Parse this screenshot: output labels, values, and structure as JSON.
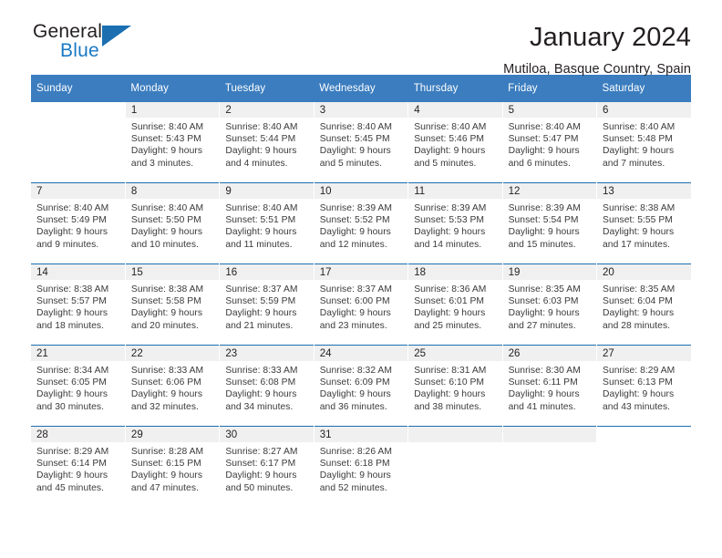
{
  "brand": {
    "name_part1": "General",
    "name_part2": "Blue",
    "triangle_icon": "triangle-icon",
    "blue": "#1b79c4"
  },
  "header": {
    "title": "January 2024",
    "location": "Mutiloa, Basque Country, Spain"
  },
  "calendar": {
    "header_bg": "#3b7dbf",
    "daynum_bg": "#f0f0f0",
    "separator_color": "#1b6fb0",
    "weekdays": [
      "Sunday",
      "Monday",
      "Tuesday",
      "Wednesday",
      "Thursday",
      "Friday",
      "Saturday"
    ],
    "weeks": [
      [
        null,
        {
          "day": "1",
          "sunrise": "Sunrise: 8:40 AM",
          "sunset": "Sunset: 5:43 PM",
          "daylight1": "Daylight: 9 hours",
          "daylight2": "and 3 minutes."
        },
        {
          "day": "2",
          "sunrise": "Sunrise: 8:40 AM",
          "sunset": "Sunset: 5:44 PM",
          "daylight1": "Daylight: 9 hours",
          "daylight2": "and 4 minutes."
        },
        {
          "day": "3",
          "sunrise": "Sunrise: 8:40 AM",
          "sunset": "Sunset: 5:45 PM",
          "daylight1": "Daylight: 9 hours",
          "daylight2": "and 5 minutes."
        },
        {
          "day": "4",
          "sunrise": "Sunrise: 8:40 AM",
          "sunset": "Sunset: 5:46 PM",
          "daylight1": "Daylight: 9 hours",
          "daylight2": "and 5 minutes."
        },
        {
          "day": "5",
          "sunrise": "Sunrise: 8:40 AM",
          "sunset": "Sunset: 5:47 PM",
          "daylight1": "Daylight: 9 hours",
          "daylight2": "and 6 minutes."
        },
        {
          "day": "6",
          "sunrise": "Sunrise: 8:40 AM",
          "sunset": "Sunset: 5:48 PM",
          "daylight1": "Daylight: 9 hours",
          "daylight2": "and 7 minutes."
        }
      ],
      [
        {
          "day": "7",
          "sunrise": "Sunrise: 8:40 AM",
          "sunset": "Sunset: 5:49 PM",
          "daylight1": "Daylight: 9 hours",
          "daylight2": "and 9 minutes."
        },
        {
          "day": "8",
          "sunrise": "Sunrise: 8:40 AM",
          "sunset": "Sunset: 5:50 PM",
          "daylight1": "Daylight: 9 hours",
          "daylight2": "and 10 minutes."
        },
        {
          "day": "9",
          "sunrise": "Sunrise: 8:40 AM",
          "sunset": "Sunset: 5:51 PM",
          "daylight1": "Daylight: 9 hours",
          "daylight2": "and 11 minutes."
        },
        {
          "day": "10",
          "sunrise": "Sunrise: 8:39 AM",
          "sunset": "Sunset: 5:52 PM",
          "daylight1": "Daylight: 9 hours",
          "daylight2": "and 12 minutes."
        },
        {
          "day": "11",
          "sunrise": "Sunrise: 8:39 AM",
          "sunset": "Sunset: 5:53 PM",
          "daylight1": "Daylight: 9 hours",
          "daylight2": "and 14 minutes."
        },
        {
          "day": "12",
          "sunrise": "Sunrise: 8:39 AM",
          "sunset": "Sunset: 5:54 PM",
          "daylight1": "Daylight: 9 hours",
          "daylight2": "and 15 minutes."
        },
        {
          "day": "13",
          "sunrise": "Sunrise: 8:38 AM",
          "sunset": "Sunset: 5:55 PM",
          "daylight1": "Daylight: 9 hours",
          "daylight2": "and 17 minutes."
        }
      ],
      [
        {
          "day": "14",
          "sunrise": "Sunrise: 8:38 AM",
          "sunset": "Sunset: 5:57 PM",
          "daylight1": "Daylight: 9 hours",
          "daylight2": "and 18 minutes."
        },
        {
          "day": "15",
          "sunrise": "Sunrise: 8:38 AM",
          "sunset": "Sunset: 5:58 PM",
          "daylight1": "Daylight: 9 hours",
          "daylight2": "and 20 minutes."
        },
        {
          "day": "16",
          "sunrise": "Sunrise: 8:37 AM",
          "sunset": "Sunset: 5:59 PM",
          "daylight1": "Daylight: 9 hours",
          "daylight2": "and 21 minutes."
        },
        {
          "day": "17",
          "sunrise": "Sunrise: 8:37 AM",
          "sunset": "Sunset: 6:00 PM",
          "daylight1": "Daylight: 9 hours",
          "daylight2": "and 23 minutes."
        },
        {
          "day": "18",
          "sunrise": "Sunrise: 8:36 AM",
          "sunset": "Sunset: 6:01 PM",
          "daylight1": "Daylight: 9 hours",
          "daylight2": "and 25 minutes."
        },
        {
          "day": "19",
          "sunrise": "Sunrise: 8:35 AM",
          "sunset": "Sunset: 6:03 PM",
          "daylight1": "Daylight: 9 hours",
          "daylight2": "and 27 minutes."
        },
        {
          "day": "20",
          "sunrise": "Sunrise: 8:35 AM",
          "sunset": "Sunset: 6:04 PM",
          "daylight1": "Daylight: 9 hours",
          "daylight2": "and 28 minutes."
        }
      ],
      [
        {
          "day": "21",
          "sunrise": "Sunrise: 8:34 AM",
          "sunset": "Sunset: 6:05 PM",
          "daylight1": "Daylight: 9 hours",
          "daylight2": "and 30 minutes."
        },
        {
          "day": "22",
          "sunrise": "Sunrise: 8:33 AM",
          "sunset": "Sunset: 6:06 PM",
          "daylight1": "Daylight: 9 hours",
          "daylight2": "and 32 minutes."
        },
        {
          "day": "23",
          "sunrise": "Sunrise: 8:33 AM",
          "sunset": "Sunset: 6:08 PM",
          "daylight1": "Daylight: 9 hours",
          "daylight2": "and 34 minutes."
        },
        {
          "day": "24",
          "sunrise": "Sunrise: 8:32 AM",
          "sunset": "Sunset: 6:09 PM",
          "daylight1": "Daylight: 9 hours",
          "daylight2": "and 36 minutes."
        },
        {
          "day": "25",
          "sunrise": "Sunrise: 8:31 AM",
          "sunset": "Sunset: 6:10 PM",
          "daylight1": "Daylight: 9 hours",
          "daylight2": "and 38 minutes."
        },
        {
          "day": "26",
          "sunrise": "Sunrise: 8:30 AM",
          "sunset": "Sunset: 6:11 PM",
          "daylight1": "Daylight: 9 hours",
          "daylight2": "and 41 minutes."
        },
        {
          "day": "27",
          "sunrise": "Sunrise: 8:29 AM",
          "sunset": "Sunset: 6:13 PM",
          "daylight1": "Daylight: 9 hours",
          "daylight2": "and 43 minutes."
        }
      ],
      [
        {
          "day": "28",
          "sunrise": "Sunrise: 8:29 AM",
          "sunset": "Sunset: 6:14 PM",
          "daylight1": "Daylight: 9 hours",
          "daylight2": "and 45 minutes."
        },
        {
          "day": "29",
          "sunrise": "Sunrise: 8:28 AM",
          "sunset": "Sunset: 6:15 PM",
          "daylight1": "Daylight: 9 hours",
          "daylight2": "and 47 minutes."
        },
        {
          "day": "30",
          "sunrise": "Sunrise: 8:27 AM",
          "sunset": "Sunset: 6:17 PM",
          "daylight1": "Daylight: 9 hours",
          "daylight2": "and 50 minutes."
        },
        {
          "day": "31",
          "sunrise": "Sunrise: 8:26 AM",
          "sunset": "Sunset: 6:18 PM",
          "daylight1": "Daylight: 9 hours",
          "daylight2": "and 52 minutes."
        },
        {
          "day": "",
          "sunrise": "",
          "sunset": "",
          "daylight1": "",
          "daylight2": ""
        },
        {
          "day": "",
          "sunrise": "",
          "sunset": "",
          "daylight1": "",
          "daylight2": ""
        },
        null
      ]
    ]
  }
}
